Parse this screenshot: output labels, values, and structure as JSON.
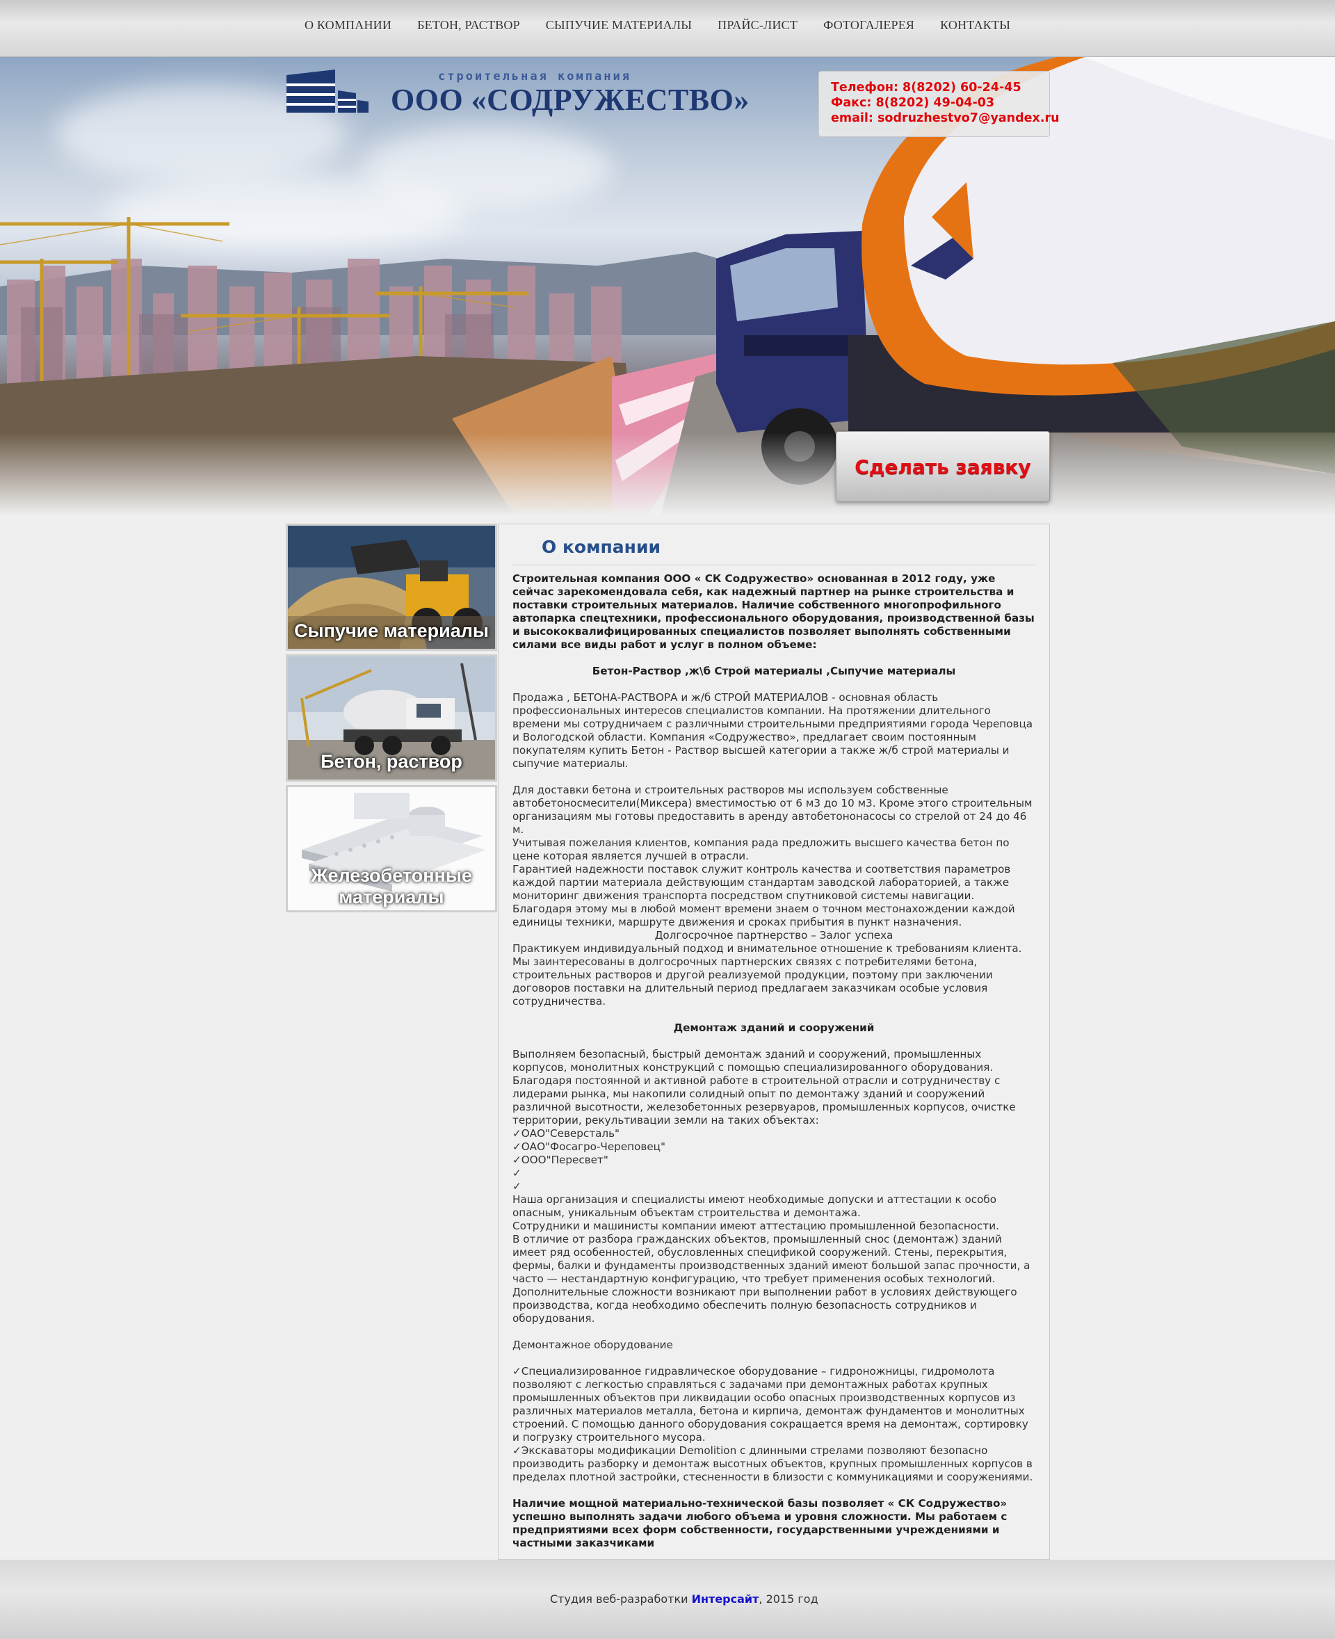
{
  "nav": [
    "О компании",
    "Бетон, раствор",
    "Сыпучие материалы",
    "Прайс-лист",
    "Фотогалерея",
    "Контакты"
  ],
  "logo": {
    "subtitle": "строительная компания",
    "name": "ООО «СОДРУЖЕСТВО»"
  },
  "contact": {
    "phone": "Телефон: 8(8202) 60-24-45",
    "fax": "Факс: 8(8202) 49-04-03",
    "email": "email: sodruzhestvo7@yandex.ru"
  },
  "order_button": "Сделать заявку",
  "side_cards": [
    {
      "caption": "Сыпучие материалы"
    },
    {
      "caption": "Бетон, раствор"
    },
    {
      "caption": "Железобетонные материалы"
    }
  ],
  "content": {
    "title": "О компании",
    "intro": "Строительная компания ООО « СК Содружество» основанная в 2012 году, уже сейчас зарекомендовала себя, как надежный партнер на рынке строительства и поставки строительных материалов. Наличие собственного многопрофильного автопарка спецтехники, профессионального оборудования, производственной базы и высококвалифицированных специалистов позволяет выполнять собственными силами все виды работ и услуг в полном объеме:",
    "heading1": "Бетон-Раствор ,ж\\б Строй материалы ,Сыпучие материалы",
    "para1": "Продажа , БЕТОНА-РАСТВОРА и ж/б  СТРОЙ МАТЕРИАЛОВ - основная область профессиональных интересов специалистов компании. На протяжении длительного времени мы сотрудничаем с различными строительными предприятиями города Череповца и Вологодской области. Компания «Содружество», предлагает своим постоянным покупателям купить Бетон - Раствор  высшей категории а также ж/б строй материалы и сыпучие материалы.",
    "para2": "Для доставки бетона и строительных растворов мы используем собственные автобетоносмесители(Миксера) вместимостью от 6 м3 до 10 м3. Кроме этого строительным организациям мы готовы предоставить в аренду автобетононасосы со стрелой от 24 до 46 м.\n Учитывая пожелания клиентов, компания рада предложить высшего качества бетон по цене которая является лучшей в отрасли.\nГарантией надежности поставок служит контроль качества и соответствия параметров каждой партии материала действующим стандартам заводской лабораторией, а также мониторинг движения транспорта посредством спутниковой системы навигации. Благодаря этому мы в любой момент времени знаем о точном местонахождении каждой единицы техники, маршруте движения и сроках прибытия в пункт назначения.",
    "partnership": "Долгосрочное партнерство – Залог успеха",
    "para3": "Практикуем индивидуальный подход и внимательное отношение к требованиям клиента.\nМы заинтересованы в долгосрочных партнерских связях с потребителями бетона, строительных растворов и другой реализуемой продукции, поэтому при заключении договоров поставки на длительный период предлагаем заказчикам особые условия сотрудничества.",
    "heading2": "Демонтаж зданий и сооружений",
    "para4": "Выполняем безопасный, быстрый демонтаж зданий и сооружений, промышленных корпусов, монолитных конструкций с помощью специализированного оборудования.\nБлагодаря постоянной и активной работе в строительной отрасли и сотрудничеству с лидерами рынка, мы накопили солидный опыт по демонтажу зданий и сооружений различной высотности, железобетонных резервуаров, промышленных корпусов, очистке территории, рекультивации земли на таких объектах:\n✓ОАО\"Северсталь\"\n✓ОАО\"Фосагро-Череповец\"\n✓ООО\"Пересвет\"\n✓\n✓\nНаша организация и специалисты имеют необходимые допуски и аттестации к особо опасным, уникальным объектам строительства и демонтажа.\nСотрудники и машинисты  компании имеют аттестацию промышленной безопасности.\n В отличие от разбора гражданских объектов, промышленный снос (демонтаж) зданий имеет ряд особенностей, обусловленных спецификой сооружений. Стены, перекрытия, фермы, балки и фундаменты производственных зданий имеют большой запас прочности, а часто — нестандартную конфигурацию, что требует применения особых технологий. Дополнительные сложности возникают при выполнении работ в условиях действующего производства, когда необходимо обеспечить полную безопасность сотрудников и оборудования.",
    "equip_title": "Демонтажное оборудование",
    "para5": "✓Специализированное гидравлическое оборудование – гидроножницы, гидромолота позволяют с легкостью справляться с задачами при демонтажных работах крупных промышленных объектов при ликвидации особо опасных производственных корпусов из различных материалов металла, бетона и кирпича, демонтаж фундаментов и монолитных строений. С помощью данного оборудования сокращается время на демонтаж, сортировку и погрузку строительного мусора.\n✓Экскаваторы модификации Demolition с длинными стрелами позволяют безопасно производить разборку и демонтаж высотных объектов, крупных промышленных корпусов в пределах плотной застройки, стесненности в близости с коммуникациями и сооружениями.",
    "closing": "Наличие мощной материально-технической базы позволяет « СК Содружество» успешно выполнять задачи любого объема и уровня сложности. Мы работаем с предприятиями всех форм собственности, государственными учреждениями и частными заказчиками"
  },
  "footer": {
    "prefix": "Студия веб-разработки ",
    "link": "Интерсайт",
    "suffix": ", 2015 год"
  },
  "colors": {
    "accent_red": "#e30d14",
    "title_blue": "#284f8a",
    "logo_blue": "#1e3872",
    "link_blue": "#1411c9"
  }
}
